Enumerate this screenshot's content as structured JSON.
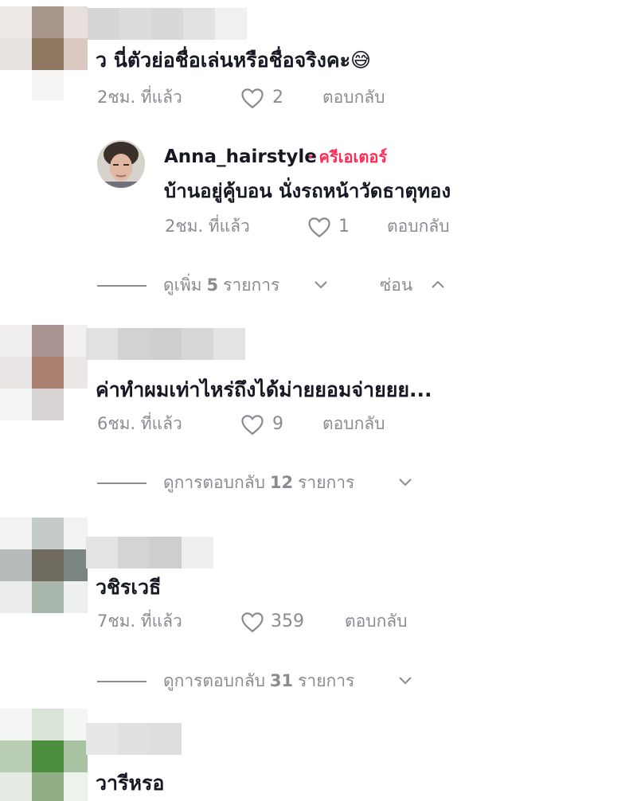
{
  "comments": [
    {
      "text": "ว นี่ตัวย่อชื่อเล่นหรือชื่อจริงคะ😅",
      "time": "2ชม. ที่แล้ว",
      "likes": "2",
      "reply_label": "ตอบกลับ"
    },
    {
      "text": "ค่าทำผมเท่าไหร่ถึงได้ม่ายยอมจ่ายยย...",
      "time": "6ชม. ที่แล้ว",
      "likes": "9",
      "reply_label": "ตอบกลับ",
      "replies_prefix": "ดูการตอบกลับ",
      "replies_count": "12",
      "replies_suffix": "รายการ"
    },
    {
      "text": "วชิรเวธี",
      "time": "7ชม. ที่แล้ว",
      "likes": "359",
      "reply_label": "ตอบกลับ",
      "replies_prefix": "ดูการตอบกลับ",
      "replies_count": "31",
      "replies_suffix": "รายการ"
    },
    {
      "text": "วารีหรอ"
    }
  ],
  "reply": {
    "author": "Anna_hairstyle",
    "badge": "· ครีเอเตอร์",
    "text": "บ้านอยู่คู้บอน นั่งรถหน้าวัดธาตุทอง",
    "time": "2ชม. ที่แล้ว",
    "likes": "1",
    "reply_label": "ตอบกลับ"
  },
  "thread_controls": {
    "more_prefix": "ดูเพิ่ม",
    "more_count": "5",
    "more_suffix": "รายการ",
    "hide_label": "ซ่อน"
  },
  "colors": {
    "text": "#161823",
    "muted": "#8a8b91",
    "creator": "#fe2c55"
  },
  "icons": [
    "heart-icon",
    "chevron-down-icon",
    "chevron-up-icon"
  ]
}
